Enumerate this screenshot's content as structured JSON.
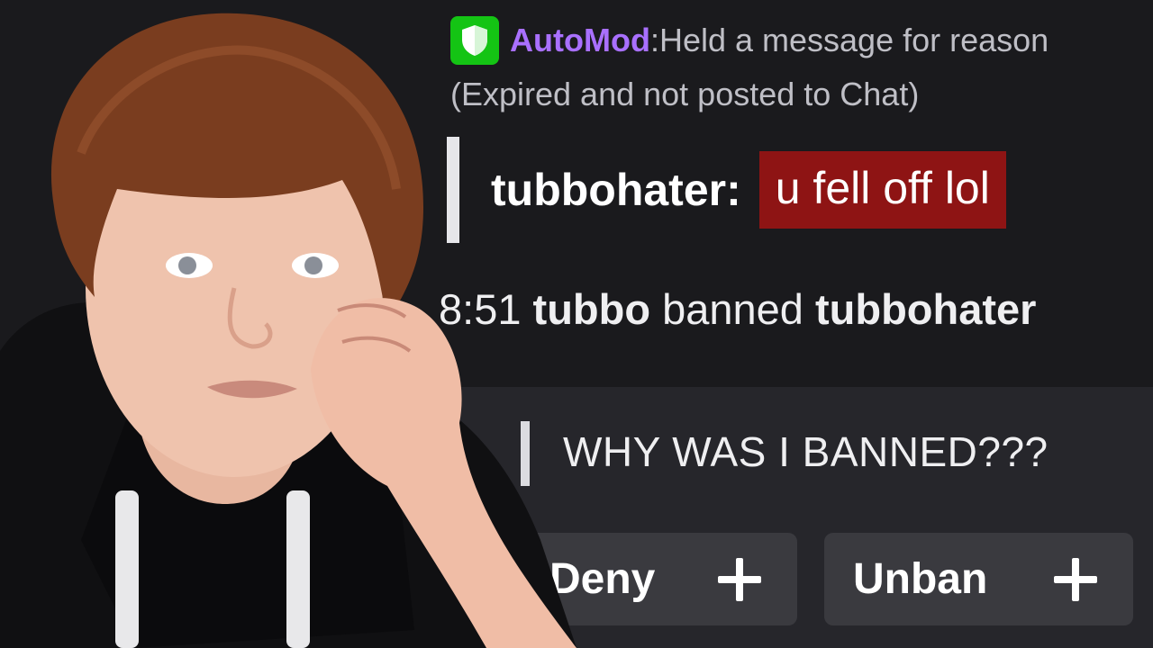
{
  "automod": {
    "badge_icon": "shield-icon",
    "badge_color": "#14c414",
    "name": "AutoMod",
    "colon": ":",
    "message": " Held a message for reason",
    "status": "(Expired and not posted to Chat)"
  },
  "held_message": {
    "username": "tubbohater:",
    "text": "u fell off lol",
    "highlight_color": "#8e1414"
  },
  "ban_event": {
    "time": "8:51",
    "moderator": "tubbo",
    "action": "banned",
    "target": "tubbohater"
  },
  "unban_request": {
    "text": "WHY WAS I BANNED???",
    "deny_label": "Deny",
    "unban_label": "Unban",
    "deny_icon": "plus-icon",
    "unban_icon": "plus-icon"
  },
  "colors": {
    "accent_purple": "#a970ff",
    "background": "#1a1a1d",
    "panel": "#26262b",
    "button": "#3a3a3f"
  }
}
